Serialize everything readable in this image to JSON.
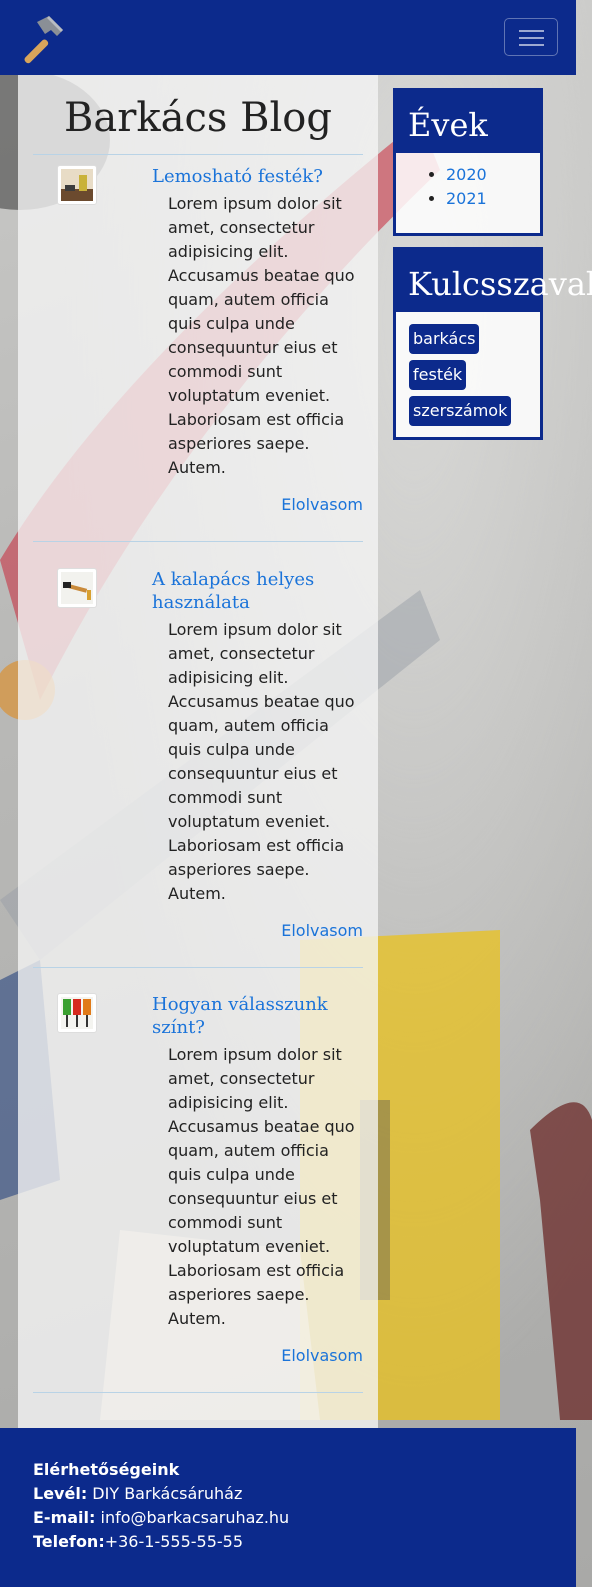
{
  "navbar": {
    "logo_icon": "hammer-icon",
    "toggler_icon": "hamburger-icon",
    "bg_color": "#0c2a8c"
  },
  "blog": {
    "title": "Barkács Blog",
    "posts": [
      {
        "title": "Lemosható festék?",
        "thumb_icon": "paint-wall-thumbnail",
        "body": "Lorem ipsum dolor sit amet, consectetur adipisicing elit. Accusamus beatae quo quam, autem officia quis culpa unde consequuntur eius et commodi sunt voluptatum eveniet. Laboriosam est officia asperiores saepe. Autem.",
        "read_more": "Elolvasom"
      },
      {
        "title": "A kalapács helyes használata",
        "thumb_icon": "hammer-nail-thumbnail",
        "body": "Lorem ipsum dolor sit amet, consectetur adipisicing elit. Accusamus beatae quo quam, autem officia quis culpa unde consequuntur eius et commodi sunt voluptatum eveniet. Laboriosam est officia asperiores saepe. Autem.",
        "read_more": "Elolvasom"
      },
      {
        "title": "Hogyan válasszunk színt?",
        "thumb_icon": "paint-rollers-thumbnail",
        "body": "Lorem ipsum dolor sit amet, consectetur adipisicing elit. Accusamus beatae quo quam, autem officia quis culpa unde consequuntur eius et commodi sunt voluptatum eveniet. Laboriosam est officia asperiores saepe. Autem.",
        "read_more": "Elolvasom"
      }
    ]
  },
  "sidebar": {
    "years_title": "Évek",
    "years": [
      "2020",
      "2021"
    ],
    "keywords_title": "Kulcsszavak",
    "keywords": [
      "barkács",
      "festék",
      "szerszámok"
    ]
  },
  "footer": {
    "heading": "Elérhetőségeink",
    "letter_label": "Levél:",
    "letter_value": " DIY Barkácsáruház",
    "email_label": "E-mail:",
    "email_value": " info@barkacsaruhaz.hu",
    "phone_label": "Telefon:",
    "phone_value": "+36-1-555-55-55"
  },
  "colors": {
    "primary": "#0c2a8c",
    "link": "#1a73d9"
  }
}
